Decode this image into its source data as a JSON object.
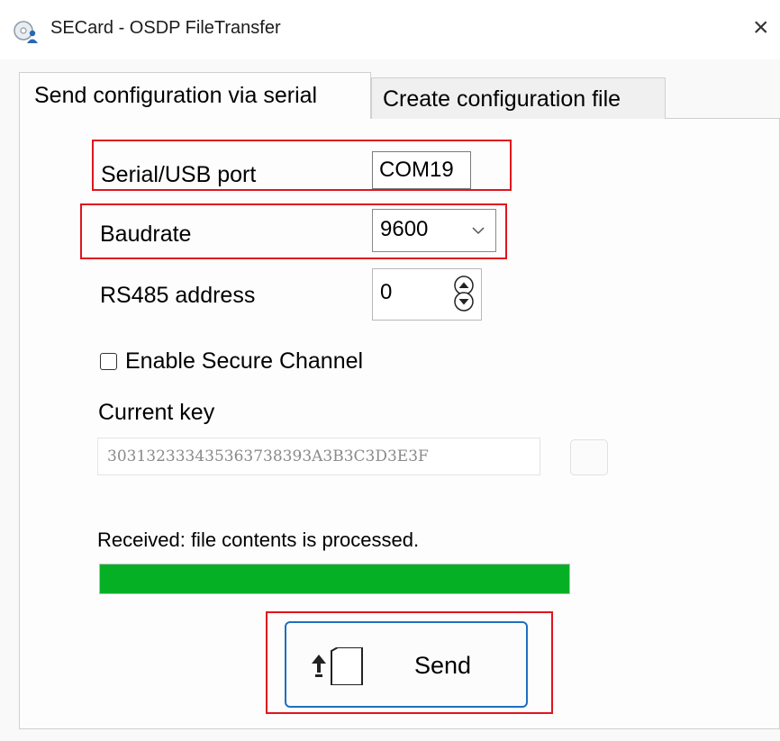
{
  "window": {
    "title": "SECard - OSDP FileTransfer",
    "close_glyph": "×",
    "icon": "app-cd-user-icon"
  },
  "tabs": [
    {
      "label": "Send configuration via serial",
      "active": true
    },
    {
      "label": "Create configuration file",
      "active": false
    }
  ],
  "form": {
    "serial_port": {
      "label": "Serial/USB port",
      "value": "COM19"
    },
    "baudrate": {
      "label": "Baudrate",
      "value": "9600"
    },
    "rs485": {
      "label": "RS485 address",
      "value": "0"
    },
    "secure_channel": {
      "label": "Enable Secure Channel",
      "checked": false
    },
    "current_key": {
      "label": "Current key",
      "value": "303132333435363738393A3B3C3D3E3F"
    }
  },
  "status": {
    "message": "Received: file contents is processed.",
    "progress": 1.0
  },
  "send_button": {
    "label": "Send",
    "icon": "sd-card-upload-icon"
  },
  "colors": {
    "highlight": "#e0141e",
    "progress": "#06b025",
    "button_border": "#1f6fbf"
  }
}
